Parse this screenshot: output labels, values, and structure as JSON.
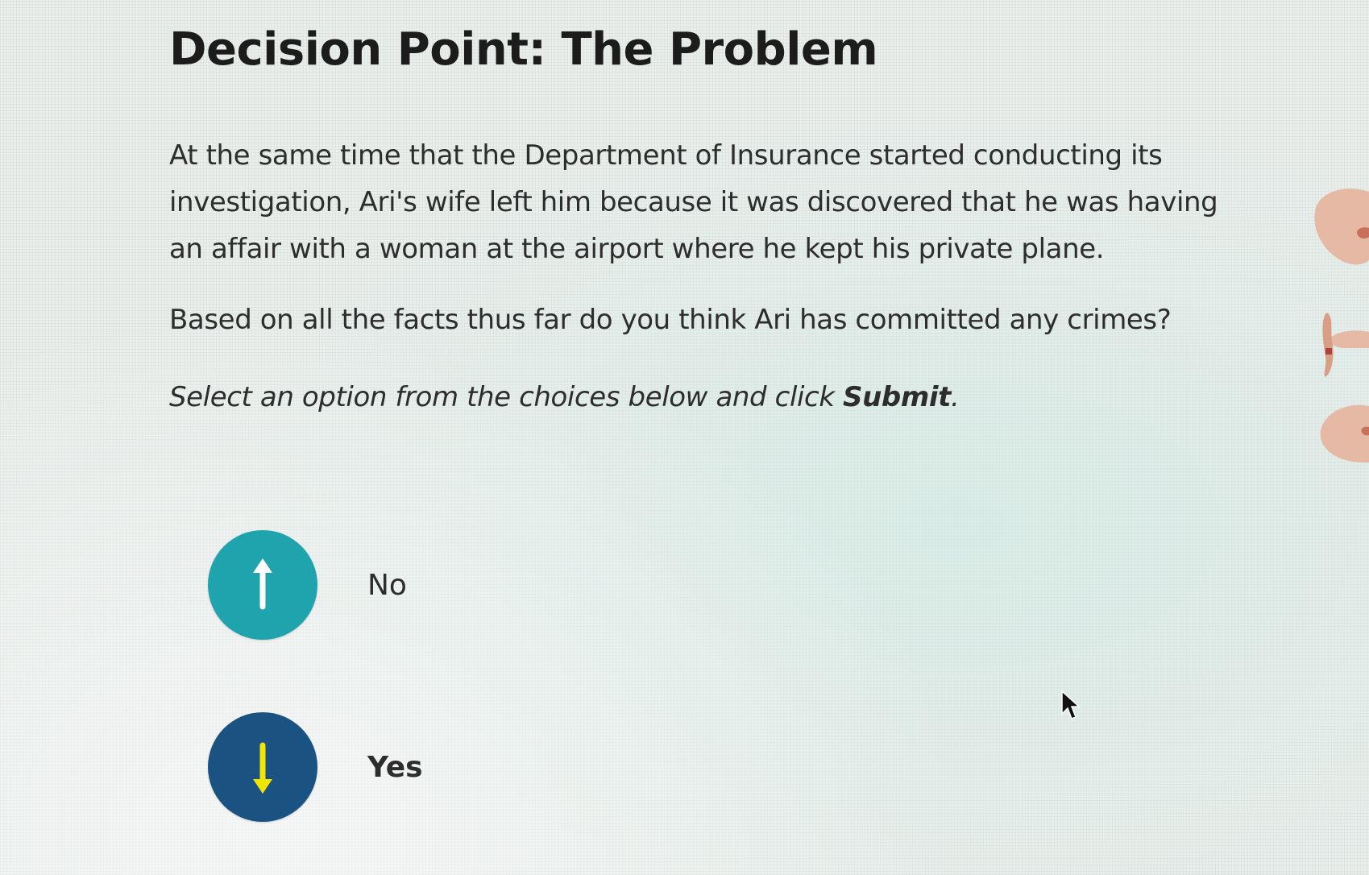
{
  "page": {
    "title": "Decision Point: The Problem",
    "paragraph1": "At the same time that the Department of Insurance started conducting its investigation, Ari's wife left him because it was discovered that he was having an affair with a woman at the airport where he kept his private plane.",
    "paragraph2": "Based on all the facts thus far do you think Ari has committed any crimes?",
    "instruction_prefix": "Select an option from the choices below and click ",
    "instruction_emphasis": "Submit",
    "instruction_suffix": "."
  },
  "options": [
    {
      "label": "No",
      "icon": "arrow-up-icon",
      "color": "#1fa3ad",
      "arrow_color": "#ffffff"
    },
    {
      "label": "Yes",
      "icon": "arrow-down-icon",
      "color": "#1a5282",
      "arrow_color": "#f2e600"
    }
  ],
  "colors": {
    "background": "#e9eeeb",
    "text": "#2d2d2d"
  }
}
